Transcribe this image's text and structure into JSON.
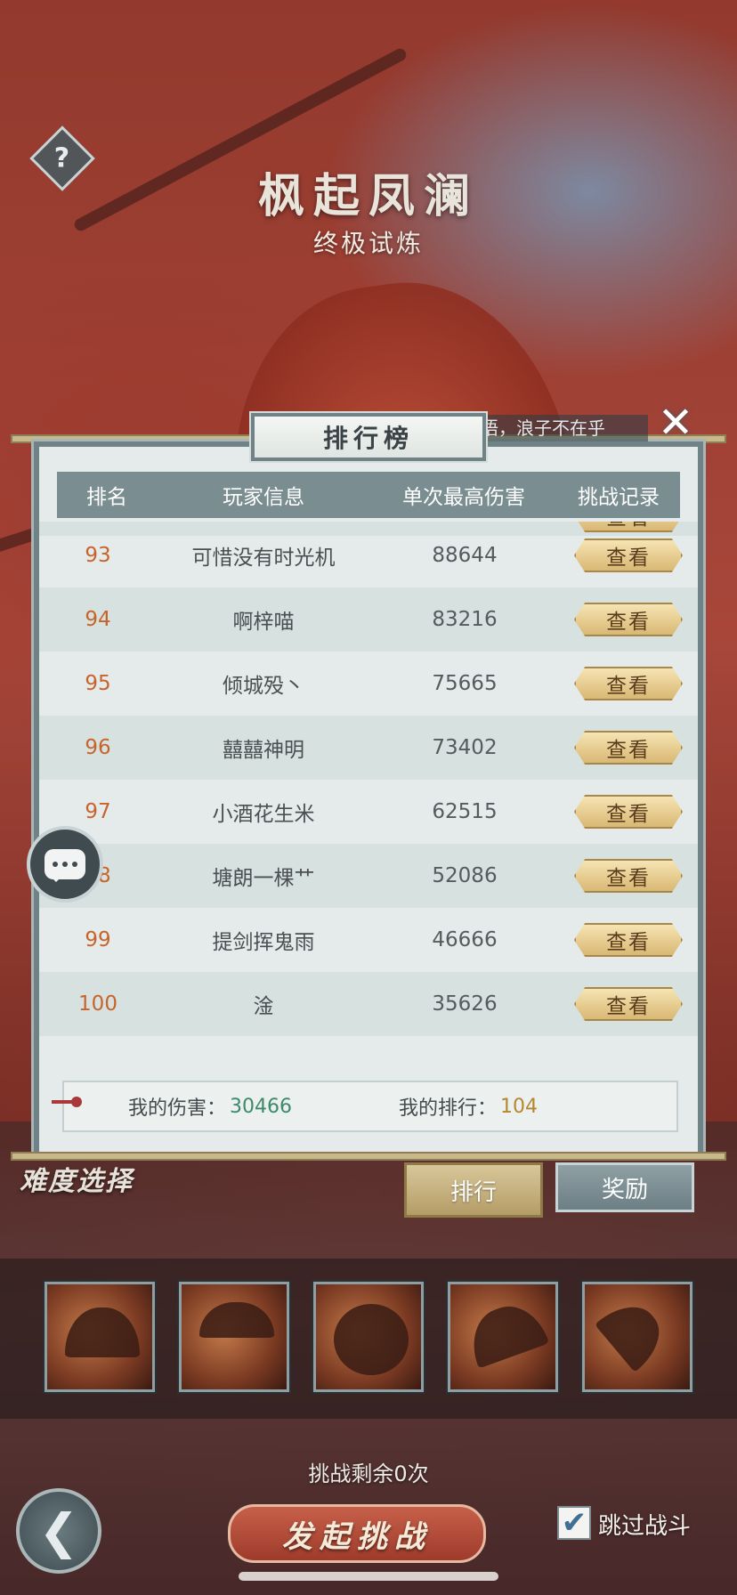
{
  "header": {
    "help_icon": "question-mark-icon",
    "help_glyph": "?",
    "title": "枫起凤澜",
    "subtitle": "终极试炼"
  },
  "panel": {
    "tab_title": "排行榜",
    "close_glyph": "✕",
    "marquee_text": "语，浪子不在乎",
    "columns": {
      "rank": "排名",
      "player": "玩家信息",
      "damage": "单次最高伤害",
      "record": "挑战记录"
    },
    "partial_row": {
      "rank": "",
      "name": "",
      "damage": "",
      "action": "查看"
    },
    "rows": [
      {
        "rank": "93",
        "name": "可惜没有时光机",
        "damage": "88644",
        "action": "查看"
      },
      {
        "rank": "94",
        "name": "啊梓喵",
        "damage": "83216",
        "action": "查看"
      },
      {
        "rank": "95",
        "name": "倾城殁丶",
        "damage": "75665",
        "action": "查看"
      },
      {
        "rank": "96",
        "name": "囍囍神明",
        "damage": "73402",
        "action": "查看"
      },
      {
        "rank": "97",
        "name": "小酒花生米",
        "damage": "62515",
        "action": "查看"
      },
      {
        "rank": "98",
        "name": "塘朗一棵艹",
        "damage": "52086",
        "action": "查看"
      },
      {
        "rank": "99",
        "name": "提剑挥鬼雨",
        "damage": "46666",
        "action": "查看"
      },
      {
        "rank": "100",
        "name": "淦",
        "damage": "35626",
        "action": "查看"
      }
    ],
    "my_damage_label": "我的伤害：",
    "my_damage_value": "30466",
    "my_rank_label": "我的排行：",
    "my_rank_value": "104"
  },
  "side": {
    "chat_icon": "chat-bubble-icon"
  },
  "lower": {
    "difficulty_label": "难度选择",
    "tab_rank": "排行",
    "tab_reward": "奖励",
    "skills": [
      "umbrella-skill-1",
      "umbrella-skill-2",
      "umbrella-skill-3",
      "umbrella-skill-4",
      "umbrella-skill-5"
    ],
    "remaining": "挑战剩余0次",
    "back_glyph": "❮",
    "challenge_button": "发起挑战",
    "skip_checked": true,
    "skip_check_glyph": "✔",
    "skip_label": "跳过战斗"
  }
}
